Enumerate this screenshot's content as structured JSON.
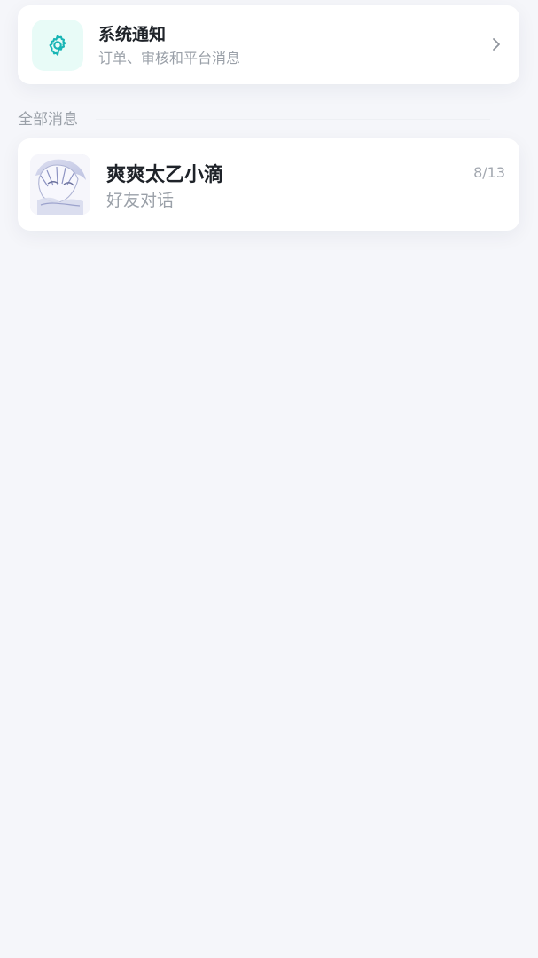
{
  "system_notification": {
    "title": "系统通知",
    "subtitle": "订单、审核和平台消息",
    "icon": "gear-icon",
    "accent_color": "#18b5b5",
    "icon_bg_color": "#e8fbf7",
    "chevron_icon": "chevron-right-icon"
  },
  "section": {
    "title": "全部消息"
  },
  "conversations": [
    {
      "name": "爽爽太乙小滴",
      "preview": "好友对话",
      "date": "8/13",
      "avatar_icon": "user-avatar-icon"
    }
  ],
  "colors": {
    "background": "#f5f6fa",
    "card": "#ffffff",
    "primary_text": "#1f2329",
    "secondary_text": "#9aa0a8"
  }
}
